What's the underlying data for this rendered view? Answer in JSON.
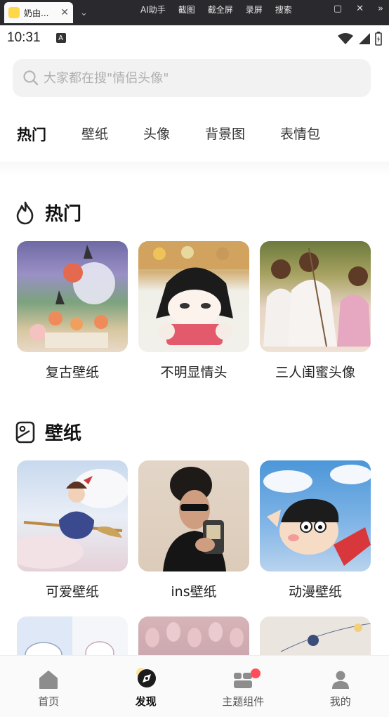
{
  "browser": {
    "tab_title": "奶由...",
    "tools": [
      "AI助手",
      "截图",
      "截全屏",
      "录屏",
      "搜索"
    ]
  },
  "status": {
    "time": "10:31"
  },
  "search": {
    "placeholder": "大家都在搜\"情侣头像\""
  },
  "categories": [
    {
      "label": "热门",
      "active": true
    },
    {
      "label": "壁纸"
    },
    {
      "label": "头像"
    },
    {
      "label": "背景图"
    },
    {
      "label": "表情包"
    }
  ],
  "sections": {
    "hot": {
      "title": "热门",
      "icon": "flame-icon",
      "items": [
        {
          "caption": "复古壁纸"
        },
        {
          "caption": "不明显情头"
        },
        {
          "caption": "三人闺蜜头像"
        }
      ]
    },
    "wallpaper": {
      "title": "壁纸",
      "icon": "wallpaper-icon",
      "items": [
        {
          "caption": "可爱壁纸"
        },
        {
          "caption": "ins壁纸"
        },
        {
          "caption": "动漫壁纸"
        }
      ]
    }
  },
  "bottom_nav": [
    {
      "label": "首页",
      "icon": "home-icon"
    },
    {
      "label": "发现",
      "icon": "discover-icon",
      "active": true
    },
    {
      "label": "主题组件",
      "icon": "theme-widgets-icon"
    },
    {
      "label": "我的",
      "icon": "profile-icon"
    }
  ],
  "colors": {
    "accent_underline": "#ffe59a",
    "badge": "#ff4d5a",
    "search_bg": "#f2f2f2"
  }
}
